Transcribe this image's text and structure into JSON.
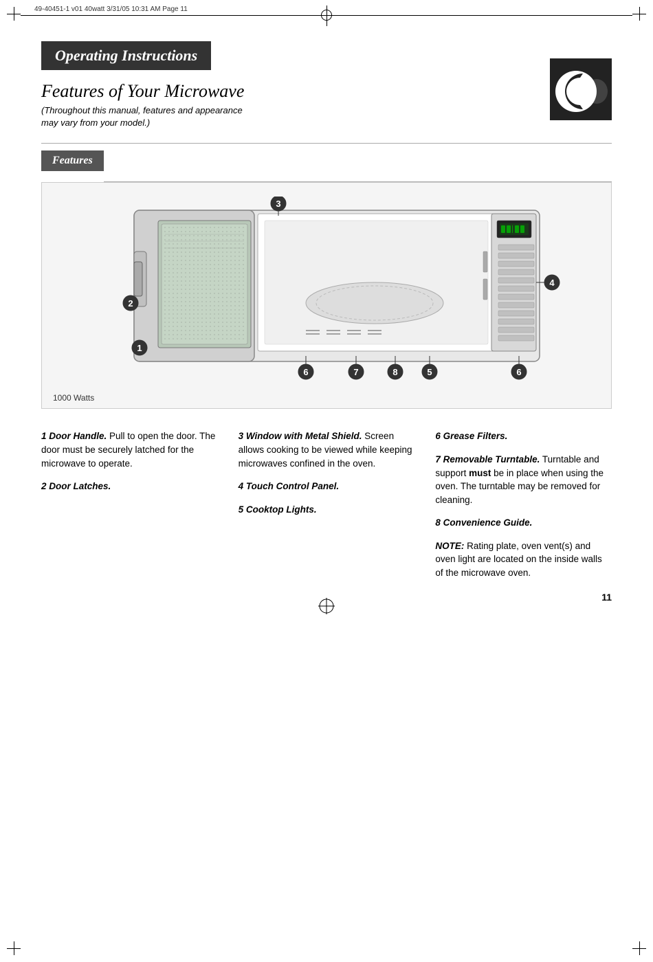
{
  "printer_mark_text": "49-40451-1 v01 40watt   3/31/05   10:31 AM   Page 11",
  "header": {
    "title": "Operating Instructions"
  },
  "section_title": "Features of Your Microwave",
  "section_subtitle": "(Throughout this manual, features and appearance\nmay vary from your model.)",
  "features_bar_label": "Features",
  "watts_label": "1000 Watts",
  "features": [
    {
      "num": "1",
      "name": "Door Handle.",
      "text": " Pull to open the door. The door must be securely latched for the microwave to operate."
    },
    {
      "num": "2",
      "name": "Door Latches.",
      "text": ""
    },
    {
      "num": "3",
      "name": "Window with Metal Shield.",
      "text": " Screen allows cooking to be viewed while keeping microwaves confined in the oven."
    },
    {
      "num": "4",
      "name": "Touch Control Panel.",
      "text": ""
    },
    {
      "num": "5",
      "name": "Cooktop Lights.",
      "text": ""
    },
    {
      "num": "6",
      "name": "Grease Filters.",
      "text": ""
    },
    {
      "num": "7",
      "name": "Removable Turntable.",
      "text": " Turntable and support ",
      "bold_text": "must",
      "text2": " be in place when using the oven. The turntable may be removed for cleaning."
    },
    {
      "num": "8",
      "name": "Convenience Guide.",
      "text": ""
    }
  ],
  "note": {
    "label": "NOTE:",
    "text": " Rating plate, oven vent(s) and oven light are located on the inside walls of the microwave oven."
  },
  "page_number": "11"
}
